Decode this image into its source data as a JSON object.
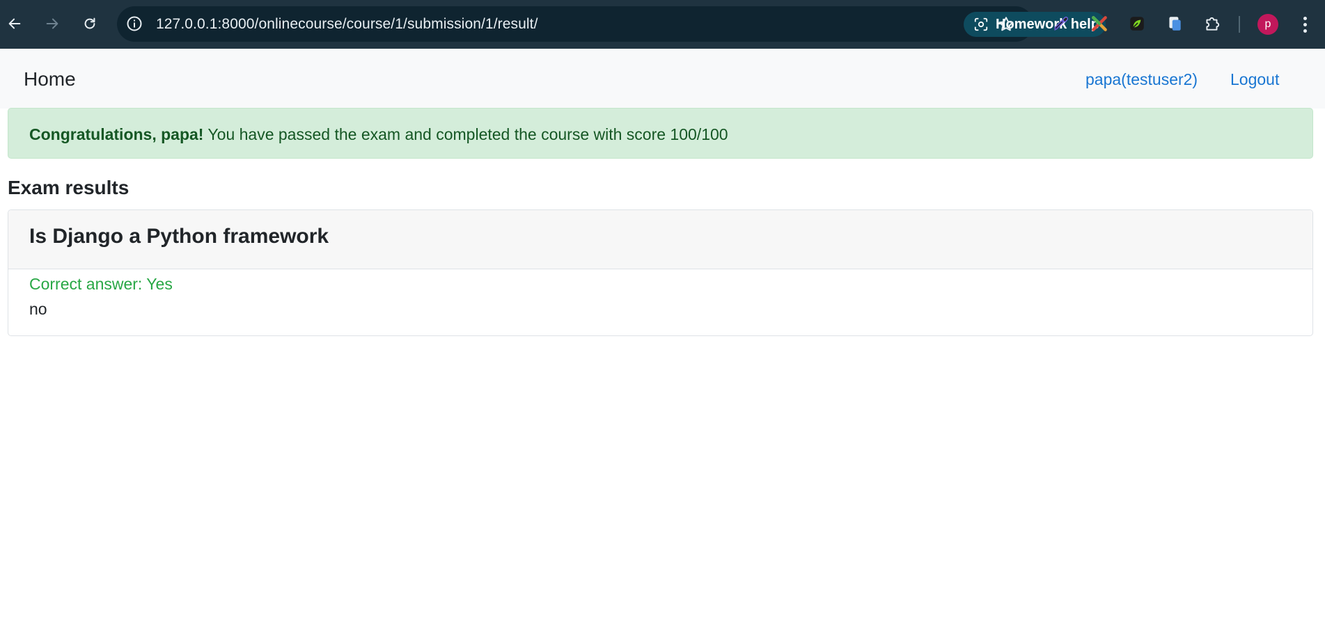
{
  "browser": {
    "url": "127.0.0.1:8000/onlinecourse/course/1/submission/1/result/",
    "homework_help_label": "Homework help",
    "profile_initial": "p",
    "icons": [
      "back-icon",
      "forward-icon",
      "reload-icon",
      "site-info-icon",
      "lens-icon",
      "star-icon",
      "eyedropper-icon",
      "x-extension-icon",
      "leaf-extension-icon",
      "copy-extension-icon",
      "puzzle-icon",
      "menu-icon"
    ],
    "colors": {
      "bar": "#1f3340",
      "omnibox": "#0f2430",
      "homework_pill": "#0e4b5e",
      "avatar": "#c2185b"
    }
  },
  "navbar": {
    "home_label": "Home",
    "user_label": "papa(testuser2)",
    "logout_label": "Logout"
  },
  "alert": {
    "bold_text": "Congratulations, papa!",
    "message": " You have passed the exam and completed the course with score 100/100"
  },
  "results": {
    "heading": "Exam results",
    "questions": [
      {
        "text": "Is Django a Python framework",
        "correct_answer": "Correct answer: Yes",
        "choice": "no"
      }
    ]
  },
  "colors": {
    "link": "#1976d2",
    "alert_bg": "#d4edda",
    "alert_text": "#155724",
    "correct_text": "#28a745"
  }
}
